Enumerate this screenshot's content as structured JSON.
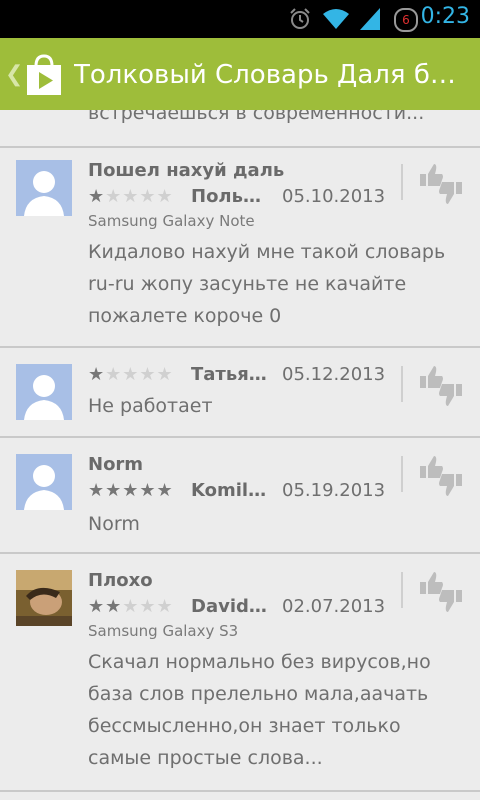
{
  "status_bar": {
    "time": "0:23",
    "notification_count": "6"
  },
  "app_bar": {
    "title": "Толковый Словарь Даля бес…",
    "back_icon": "chevron-left-icon",
    "app_icon": "play-store-bag-icon"
  },
  "previous_review_tail": "встречаешься в современности...",
  "reviews": [
    {
      "title": "Пошел нахуй даль",
      "rating": 1,
      "author": "Поль…",
      "date": "05.10.2013",
      "device": "Samsung Galaxy Note",
      "lines": [
        "Кидалово нахуй мне такой словарь",
        "ru-ru жопу засуньте не качайте",
        "пожалете короче 0"
      ]
    },
    {
      "title": "",
      "rating": 1,
      "author": "Татья…",
      "date": "05.12.2013",
      "device": "",
      "lines": [
        "Не работает"
      ]
    },
    {
      "title": "Norm",
      "rating": 5,
      "author": "Komil…",
      "date": "05.19.2013",
      "device": "",
      "lines": [
        "Norm"
      ]
    },
    {
      "title": "Плохо",
      "rating": 2,
      "author": "David…",
      "date": "02.07.2013",
      "device": "Samsung Galaxy S3",
      "lines": [
        "Скачал нормально без  вирусов,но",
        "база слов прелельно мала,аачать",
        "бессмысленно,он знает только",
        "самые простые слова..."
      ]
    }
  ],
  "colors": {
    "accent_bar": "#9ebd3a",
    "time": "#33b5e5",
    "avatar_placeholder": "#a8bfe6"
  }
}
